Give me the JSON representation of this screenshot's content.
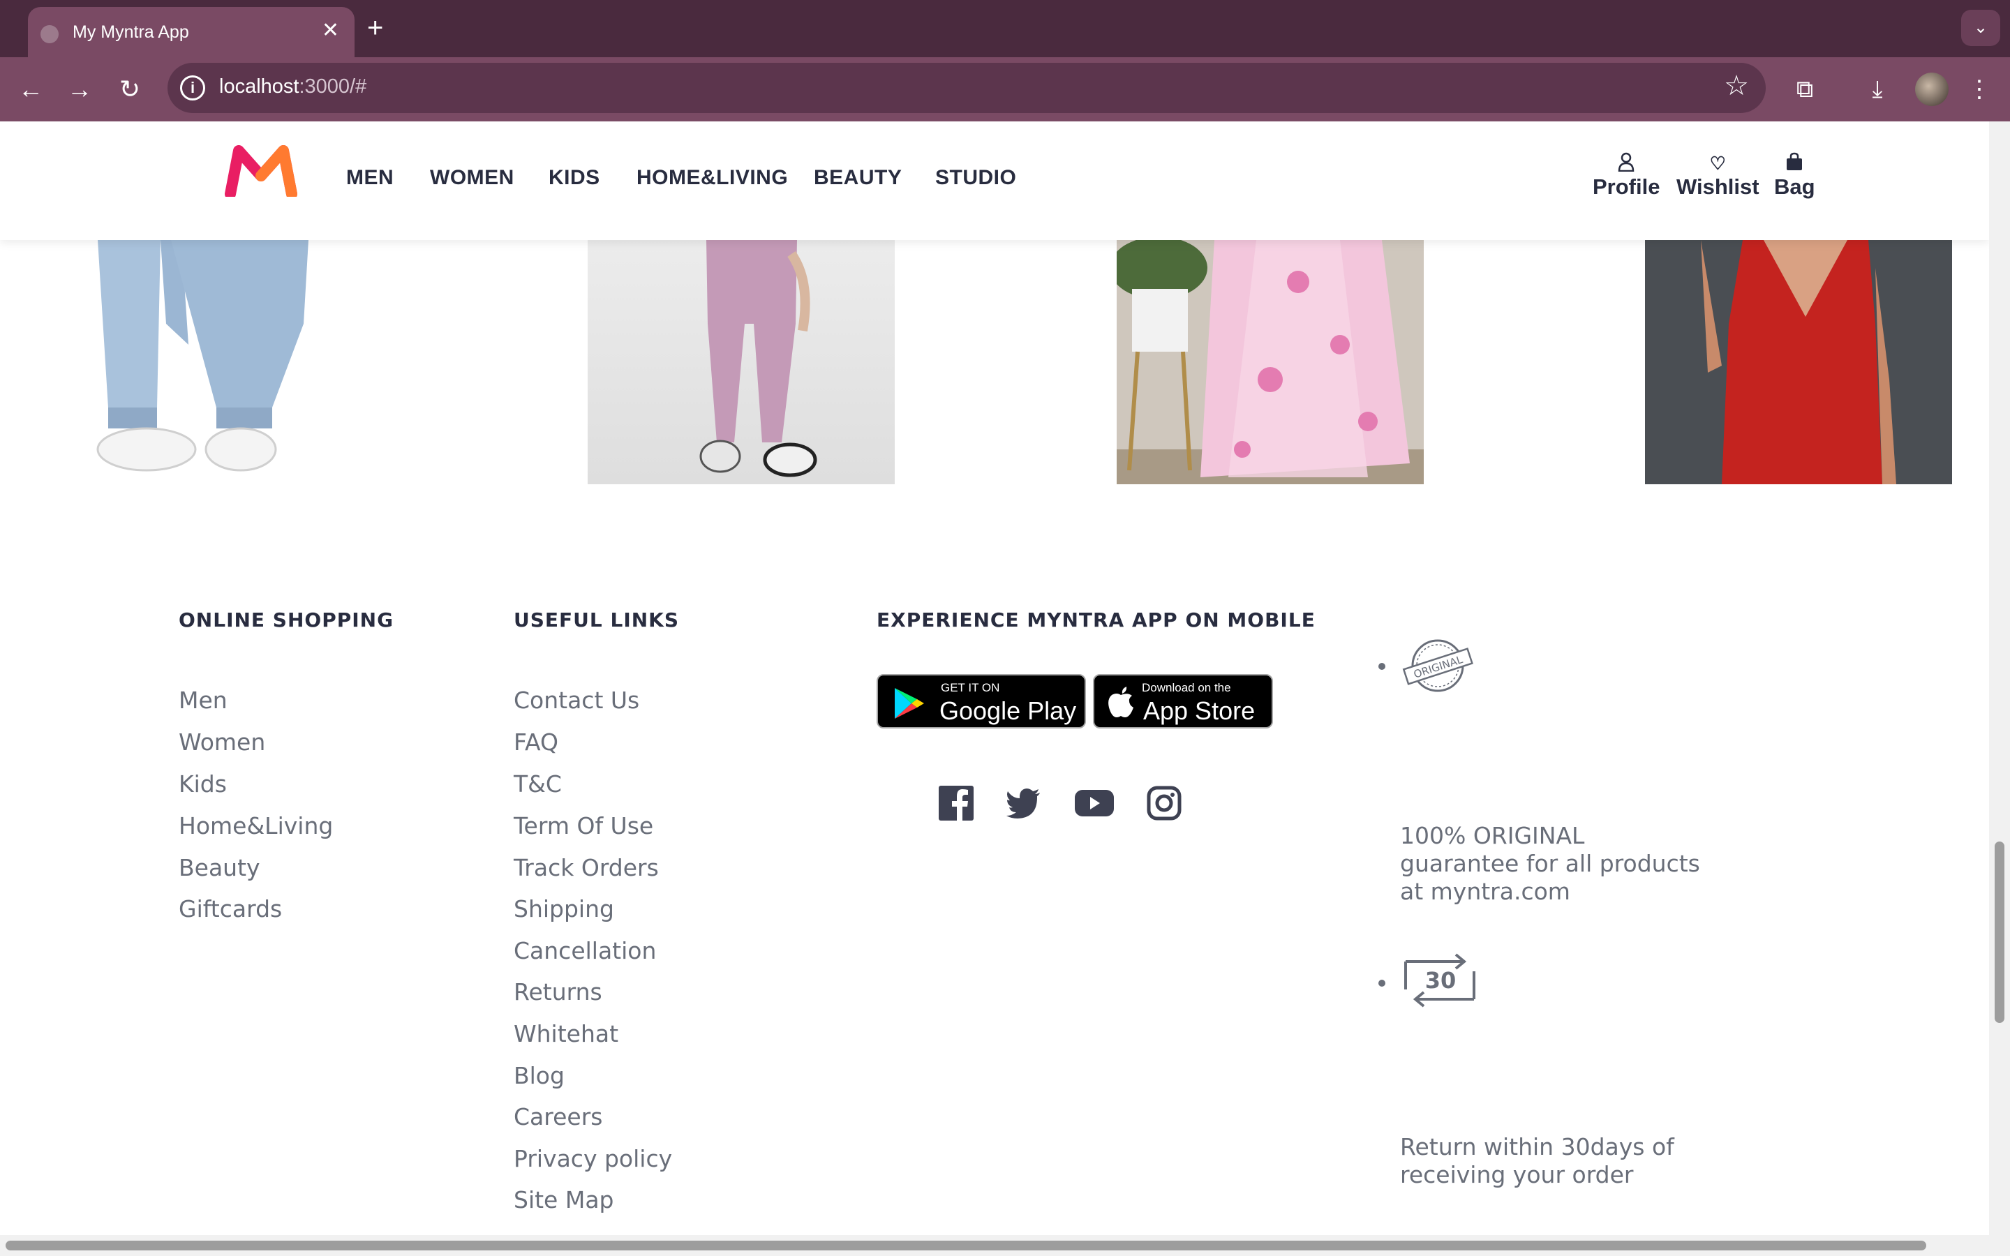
{
  "browser": {
    "tab_title": "My Myntra App",
    "tab_close": "✕",
    "new_tab": "+",
    "url_host": "localhost",
    "url_path": ":3000/#",
    "icons": [
      "back-icon",
      "forward-icon",
      "reload-icon",
      "info-icon",
      "star-icon",
      "extensions-icon",
      "download-icon",
      "avatar",
      "menu-icon"
    ]
  },
  "header": {
    "nav": [
      "MEN",
      "WOMEN",
      "KIDS",
      "HOME&LIVING",
      "BEAUTY",
      "STUDIO"
    ],
    "actions": [
      {
        "label": "Profile",
        "icon": "profile-icon"
      },
      {
        "label": "Wishlist",
        "icon": "heart-icon"
      },
      {
        "label": "Bag",
        "icon": "bag-icon"
      }
    ],
    "brand_colors": {
      "logo_pink": "#e91e63",
      "logo_orange": "#ff7a30"
    }
  },
  "footer": {
    "online_shopping": {
      "heading": "ONLINE SHOPPING",
      "links": [
        "Men",
        "Women",
        "Kids",
        "Home&Living",
        "Beauty",
        "Giftcards"
      ]
    },
    "useful_links": {
      "heading": "USEFUL LINKS",
      "links": [
        "Contact Us",
        "FAQ",
        "T&C",
        "Term Of Use",
        "Track Orders",
        "Shipping",
        "Cancellation",
        "Returns",
        "Whitehat",
        "Blog",
        "Careers",
        "Privacy policy",
        "Site Map"
      ]
    },
    "app": {
      "heading": "EXPERIENCE MYNTRA APP ON MOBILE",
      "google_small": "GET IT ON",
      "google_big": "Google Play",
      "apple_small": "Download on the",
      "apple_big": "App Store",
      "social_icons": [
        "facebook-icon",
        "twitter-icon",
        "youtube-icon",
        "instagram-icon"
      ]
    },
    "promos": {
      "original_badge": "ORIGINAL",
      "original_text": "100% ORIGINAL guarantee for all products at myntra.com",
      "return_badge": "30",
      "return_text": "Return within 30days of receiving your order"
    }
  }
}
